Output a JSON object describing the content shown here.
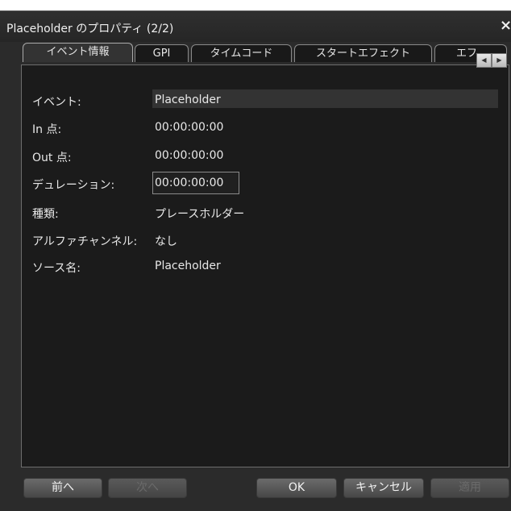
{
  "window": {
    "title": "Placeholder のプロパティ (2/2)",
    "close_glyph": "×"
  },
  "tabs": [
    {
      "label": "イベント情報",
      "active": true
    },
    {
      "label": "GPI"
    },
    {
      "label": "タイムコード"
    },
    {
      "label": "スタートエフェクト"
    },
    {
      "label": "エフ"
    }
  ],
  "tab_scroll": {
    "left_glyph": "◀",
    "right_glyph": "▶"
  },
  "properties": {
    "event": {
      "label": "イベント:",
      "value": "Placeholder"
    },
    "in_point": {
      "label": "In 点:",
      "value": "00:00:00:00"
    },
    "out_point": {
      "label": "Out 点:",
      "value": "00:00:00:00"
    },
    "duration": {
      "label": "デュレーション:",
      "value": "00:00:00:00"
    },
    "type": {
      "label": "種類:",
      "value": "プレースホルダー"
    },
    "alpha_channel": {
      "label": "アルファチャンネル:",
      "value": "なし"
    },
    "source_name": {
      "label": "ソース名:",
      "value": "Placeholder"
    }
  },
  "buttons": {
    "prev": "前へ",
    "next": "次へ",
    "ok": "OK",
    "cancel": "キャンセル",
    "apply": "適用"
  }
}
